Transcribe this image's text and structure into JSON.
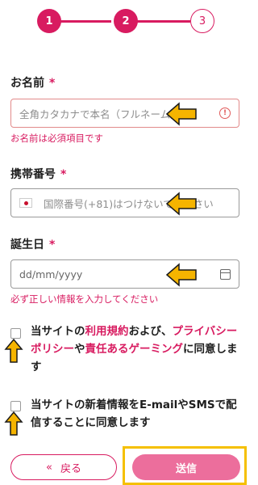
{
  "stepper": {
    "steps": [
      "1",
      "2",
      "3"
    ],
    "current": 2
  },
  "name_field": {
    "label": "お名前",
    "required": "*",
    "placeholder": "全角カタカナで本名（フルネーム）",
    "error": "お名前は必須項目です"
  },
  "phone_field": {
    "label": "携帯番号",
    "required": "*",
    "placeholder": "国際番号(+81)はつけないでください"
  },
  "birthday_field": {
    "label": "誕生日",
    "required": "*",
    "placeholder": "dd/mm/yyyy",
    "error": "必ず正しい情報を入力してください"
  },
  "terms_checkbox": {
    "t1": "当サイトの",
    "link1": "利用規約",
    "t2": "および、",
    "link2": "プライバシーポリシー",
    "t3": "や",
    "link3": "責任あるゲーミング",
    "t4": "に同意します"
  },
  "newsletter_checkbox": {
    "text": "当サイトの新着情報をE-mailやSMSで配信することに同意します"
  },
  "buttons": {
    "back_icon": "«",
    "back": "戻る",
    "submit": "送信"
  },
  "colors": {
    "accent": "#d81b60",
    "submit_bg": "#ec6e9c",
    "arrow": "#f5b400",
    "highlight": "#f5c000"
  },
  "icons": [
    "alert-circle-icon",
    "japan-flag-icon",
    "calendar-icon",
    "pointer-arrow-icon"
  ]
}
